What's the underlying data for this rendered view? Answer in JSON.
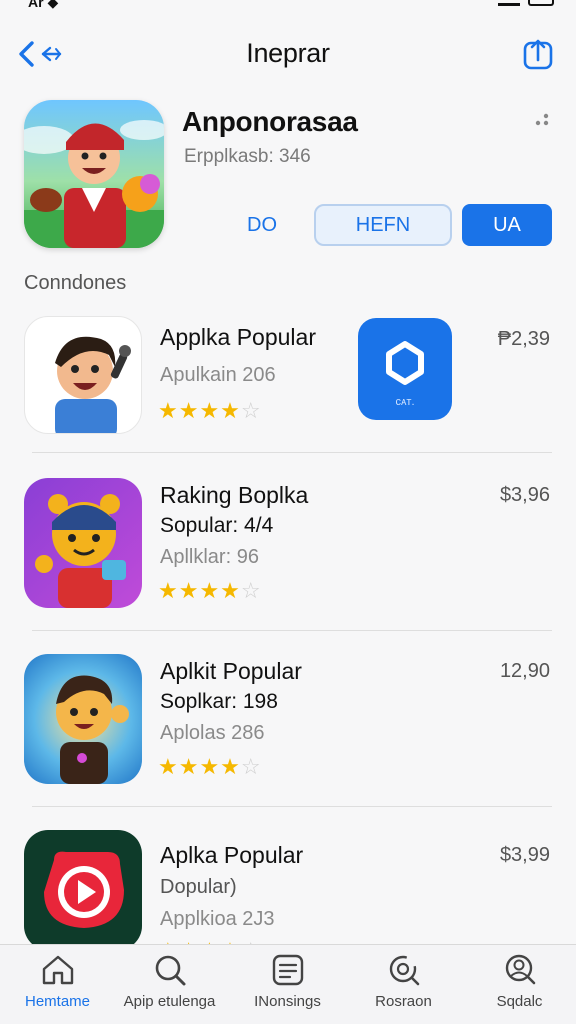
{
  "status": {
    "left": "Ar ◆",
    "icons": [
      "signal-icon",
      "battery-icon"
    ]
  },
  "navbar": {
    "title": "Ineprar",
    "back_icon": "chevron-left-icon",
    "share_icon": "share-icon"
  },
  "hero": {
    "name": "Anponorasaa",
    "subtitle": "Erpplkasb: 346",
    "buttons": {
      "do": "DO",
      "hefn": "HEFN",
      "ua": "UA"
    }
  },
  "section": {
    "title": "Conndones"
  },
  "list": [
    {
      "title": "Applka Popular",
      "subtitle": "",
      "meta": "Apulkain 206",
      "price": "₱2,39",
      "rating": 4
    },
    {
      "title": "Raking Boplka",
      "subtitle": "Sopular: 4/4",
      "meta": "Apllklar: 96",
      "price": "$3,96",
      "rating": 4
    },
    {
      "title": "Aplkit Popular",
      "subtitle": "Soplkar: 198",
      "meta": "Aplolas 286",
      "price": "12,90",
      "rating": 4
    },
    {
      "title": "Aplka Popular",
      "subtitle": "Dopular)",
      "meta": "Applkioa 2J3",
      "price": "$3,99",
      "rating": 4
    }
  ],
  "promo": {
    "label": "ᴄᴀᴛ."
  },
  "tabs": [
    {
      "label": "Hemtame",
      "icon": "home-icon",
      "active": true
    },
    {
      "label": "Apip etulenga",
      "icon": "search-icon",
      "active": false
    },
    {
      "label": "INonsings",
      "icon": "list-icon",
      "active": false
    },
    {
      "label": "Rosraon",
      "icon": "refresh-search-icon",
      "active": false
    },
    {
      "label": "Sqdalc",
      "icon": "profile-search-icon",
      "active": false
    }
  ],
  "colors": {
    "accent": "#1a73e8",
    "star": "#f5b800",
    "background": "#f7f7f8"
  }
}
